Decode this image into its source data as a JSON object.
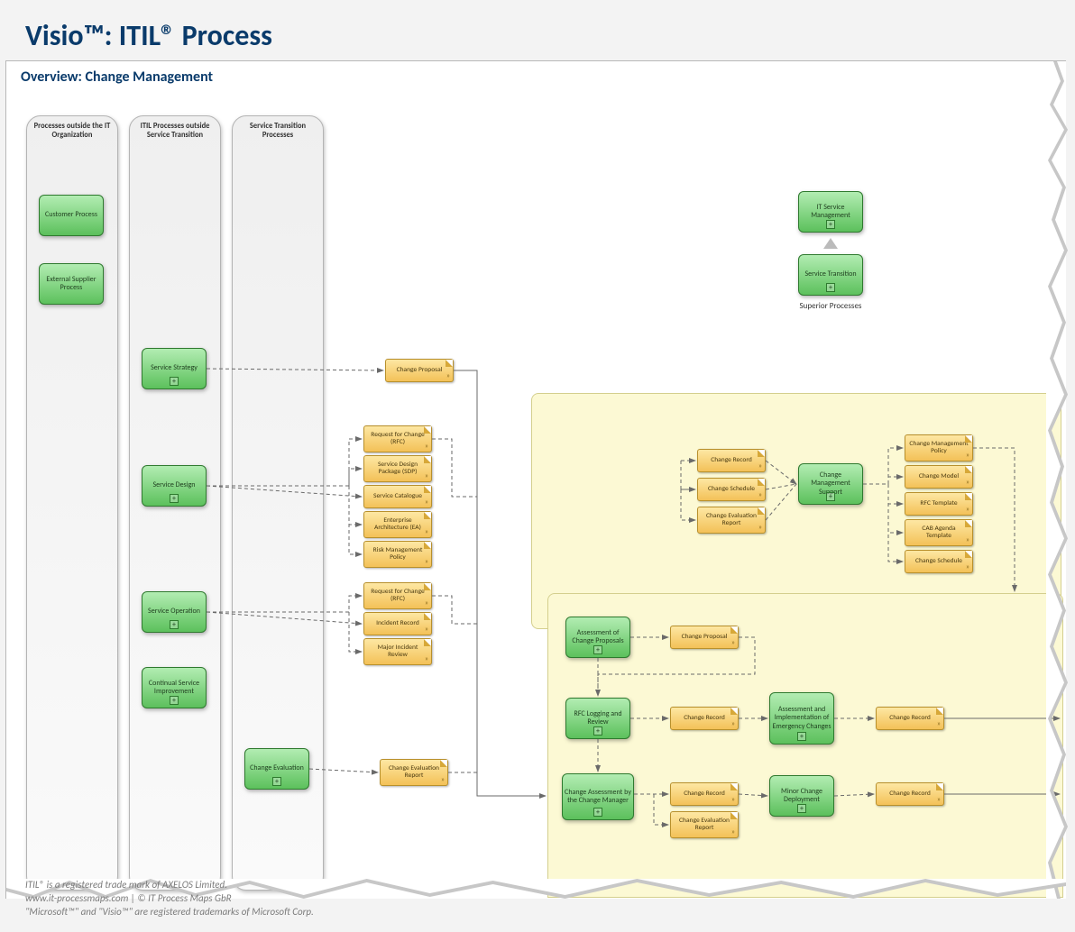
{
  "page_title": "Visio™: ITIL® Process",
  "subtitle": "Overview: Change Management",
  "lanes": {
    "outside_it": "Processes outside the IT Organization",
    "outside_st": "ITIL Processes outside Service Transition",
    "st_processes": "Service Transition Processes"
  },
  "hierarchy": {
    "top": "IT Service Management",
    "bottom": "Service Transition",
    "caption": "Superior Processes"
  },
  "procs": {
    "customer": "Customer Process",
    "supplier": "External Supplier Process",
    "strategy": "Service Strategy",
    "design": "Service Design",
    "operation": "Service Operation",
    "csi": "Continual Service Improvement",
    "change_eval": "Change Evaluation",
    "cm_support": "Change Management Support",
    "assess_proposals": "Assessment of Change Proposals",
    "rfc_logging": "RFC Logging and Review",
    "assess_impl_emerg": "Assessment and Implementation of Emergency Changes",
    "change_assess_mgr": "Change Assessment by the Change Manager",
    "minor_deploy": "Minor Change Deployment"
  },
  "docs": {
    "change_proposal": "Change Proposal",
    "rfc": "Request for Change (RFC)",
    "sdp": "Service Design Package (SDP)",
    "svc_catalogue": "Service Catalogue",
    "ea": "Enterprise Architecture (EA)",
    "risk_policy": "Risk Management Policy",
    "rfc2": "Request for Change (RFC)",
    "incident_rec": "Incident Record",
    "major_incident": "Major Incident Review",
    "change_eval_rpt": "Change Evaluation Report",
    "change_record": "Change Record",
    "change_schedule": "Change Schedule",
    "change_eval_rpt2": "Change Evaluation Report",
    "cm_policy": "Change Management Policy",
    "change_model": "Change Model",
    "rfc_template": "RFC Template",
    "cab_agenda": "CAB Agenda Template",
    "change_schedule2": "Change Schedule",
    "change_proposal2": "Change Proposal",
    "change_record2": "Change Record",
    "change_record3": "Change Record",
    "change_record4": "Change Record",
    "change_record5": "Change Record",
    "change_eval_rpt3": "Change Evaluation Report"
  },
  "footer": {
    "l1": "ITIL® is a registered trade mark of AXELOS Limited.",
    "l2": "www.it-processmaps.com | © IT Process Maps GbR",
    "l3": "\"Microsoft™\" and \"Visio™\" are registered trademarks of Microsoft Corp."
  }
}
